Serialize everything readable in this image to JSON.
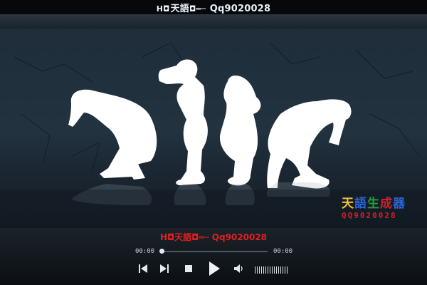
{
  "window": {
    "title_glyph_left": "H◘",
    "title_name": "天語",
    "title_glyph_right": "◘═─",
    "title_qq": " Qq9020028"
  },
  "video": {
    "watermark": {
      "line1": [
        "天",
        "語",
        "生",
        "成",
        "器"
      ],
      "line2": "QQ9020028",
      "colors": [
        "#f2c43a",
        "#2b65d9",
        "#2a9e3a",
        "#d0202a"
      ]
    }
  },
  "player": {
    "caption": "H◘天語◘═─ Qq9020028",
    "time_current": "00:00",
    "time_total": "00:00",
    "progress_fraction": 0,
    "icons": {
      "previous": "skip-previous-icon",
      "next": "skip-next-icon",
      "stop": "stop-icon",
      "play": "play-icon",
      "volume": "volume-icon"
    }
  }
}
